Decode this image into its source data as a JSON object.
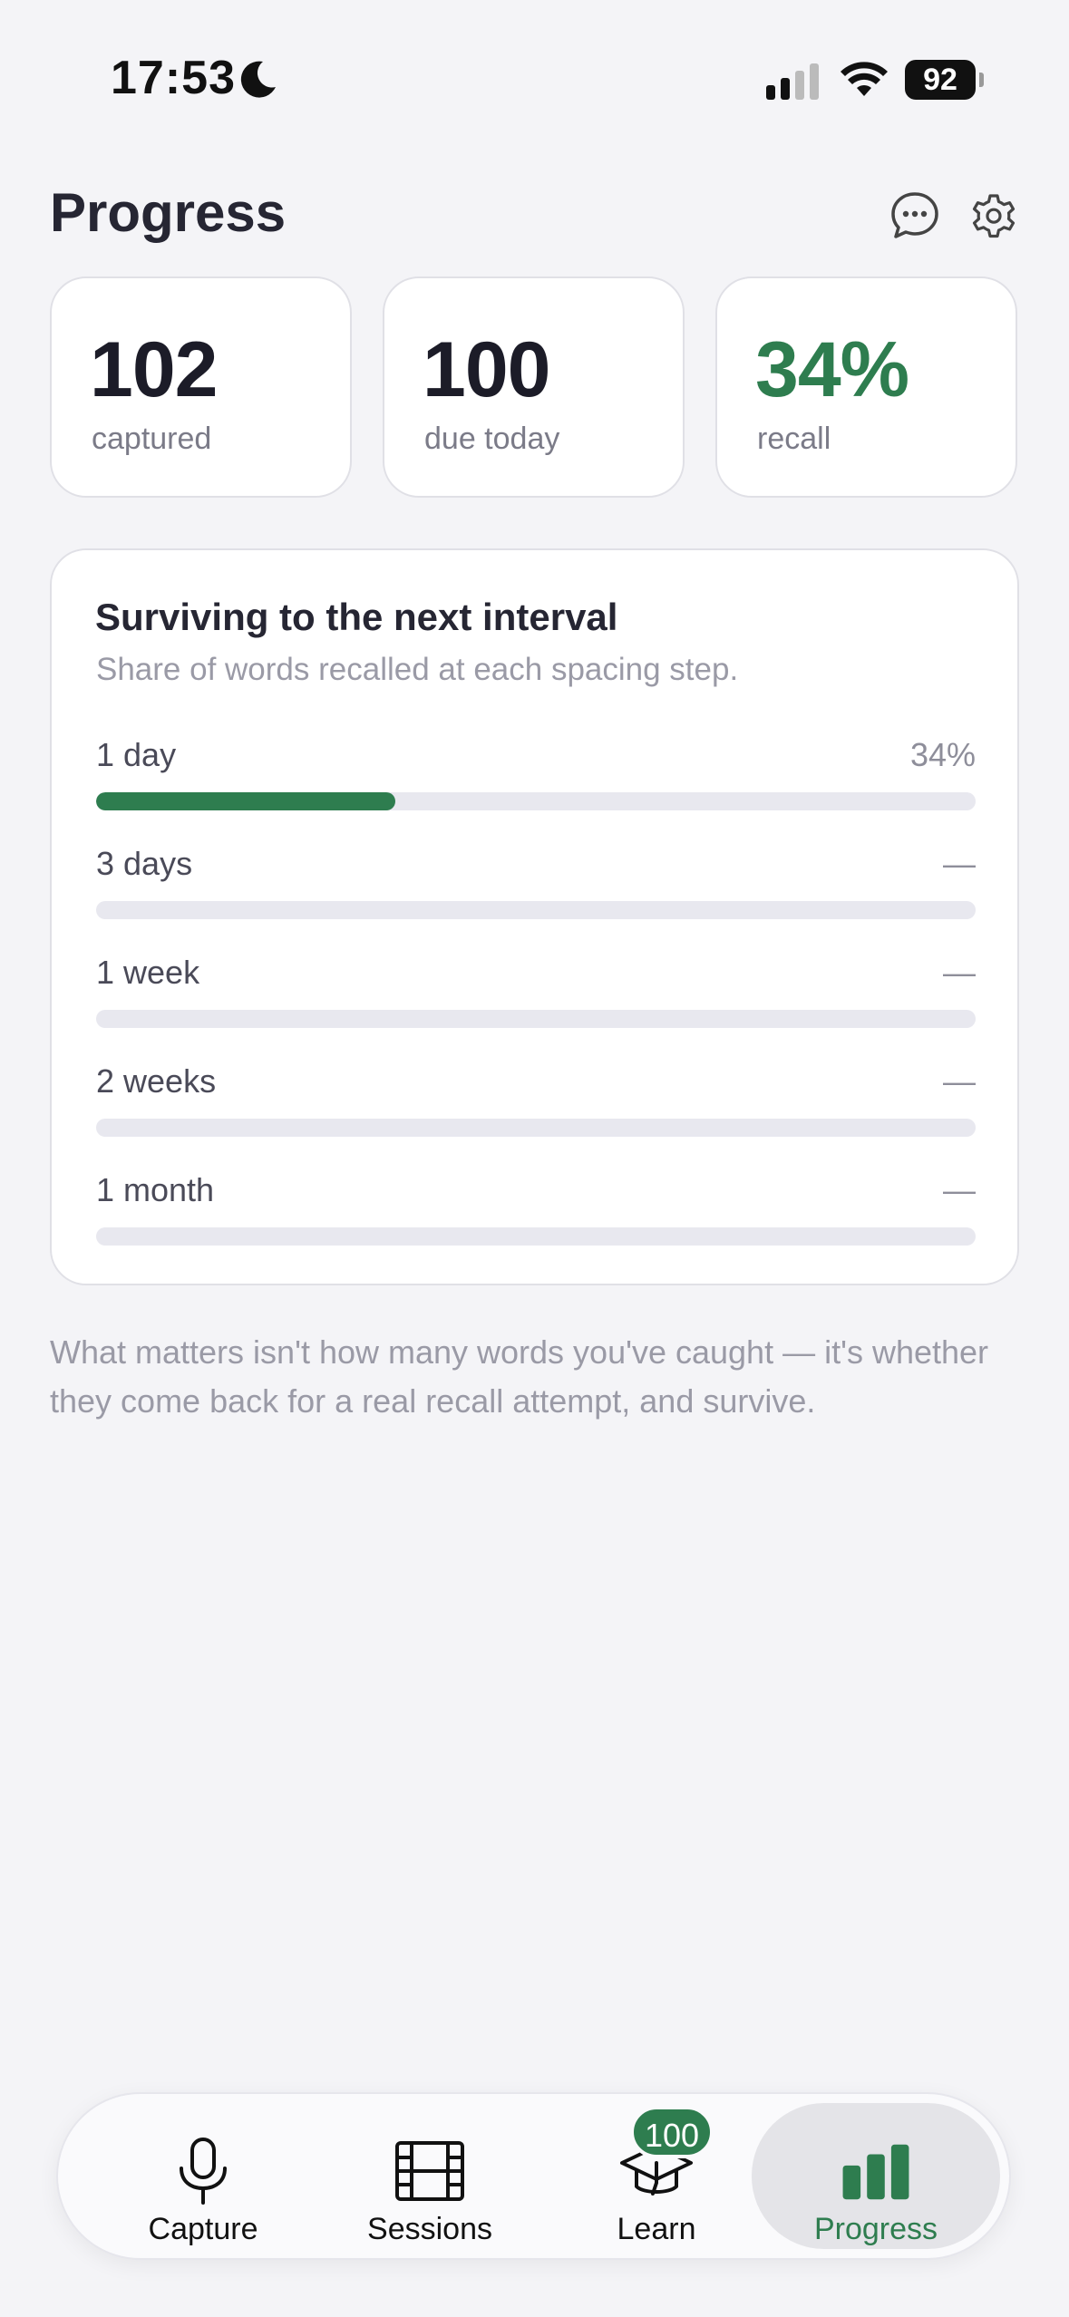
{
  "status_bar": {
    "time": "17:53",
    "battery": "92"
  },
  "header": {
    "title": "Progress",
    "icons": [
      "chat-icon",
      "gear-icon"
    ]
  },
  "stats": [
    {
      "value": "102",
      "label": "captured"
    },
    {
      "value": "100",
      "label": "due today"
    },
    {
      "value": "34%",
      "label": "recall",
      "color": "#2e7d4f"
    }
  ],
  "interval_card": {
    "title": "Surviving to the next interval",
    "subtitle": "Share of words recalled at each spacing step.",
    "rows": [
      {
        "label": "1 day",
        "value": "34%",
        "fraction": 0.34
      },
      {
        "label": "3 days",
        "value": "—",
        "fraction": 0
      },
      {
        "label": "1 week",
        "value": "—",
        "fraction": 0
      },
      {
        "label": "2 weeks",
        "value": "—",
        "fraction": 0
      },
      {
        "label": "1 month",
        "value": "—",
        "fraction": 0
      }
    ]
  },
  "footnote": "What matters isn't how many words you've caught — it's whether they come back for a real recall attempt, and survive.",
  "tab_bar": {
    "tabs": [
      {
        "label": "Capture",
        "icon": "microphone-icon"
      },
      {
        "label": "Sessions",
        "icon": "film-icon"
      },
      {
        "label": "Learn",
        "icon": "graduation-cap-icon",
        "badge": "100"
      },
      {
        "label": "Progress",
        "icon": "bar-chart-icon",
        "active": true
      }
    ]
  },
  "colors": {
    "accent": "#2e7d4f",
    "background": "#f4f4f7",
    "track": "#e8e8ef"
  }
}
